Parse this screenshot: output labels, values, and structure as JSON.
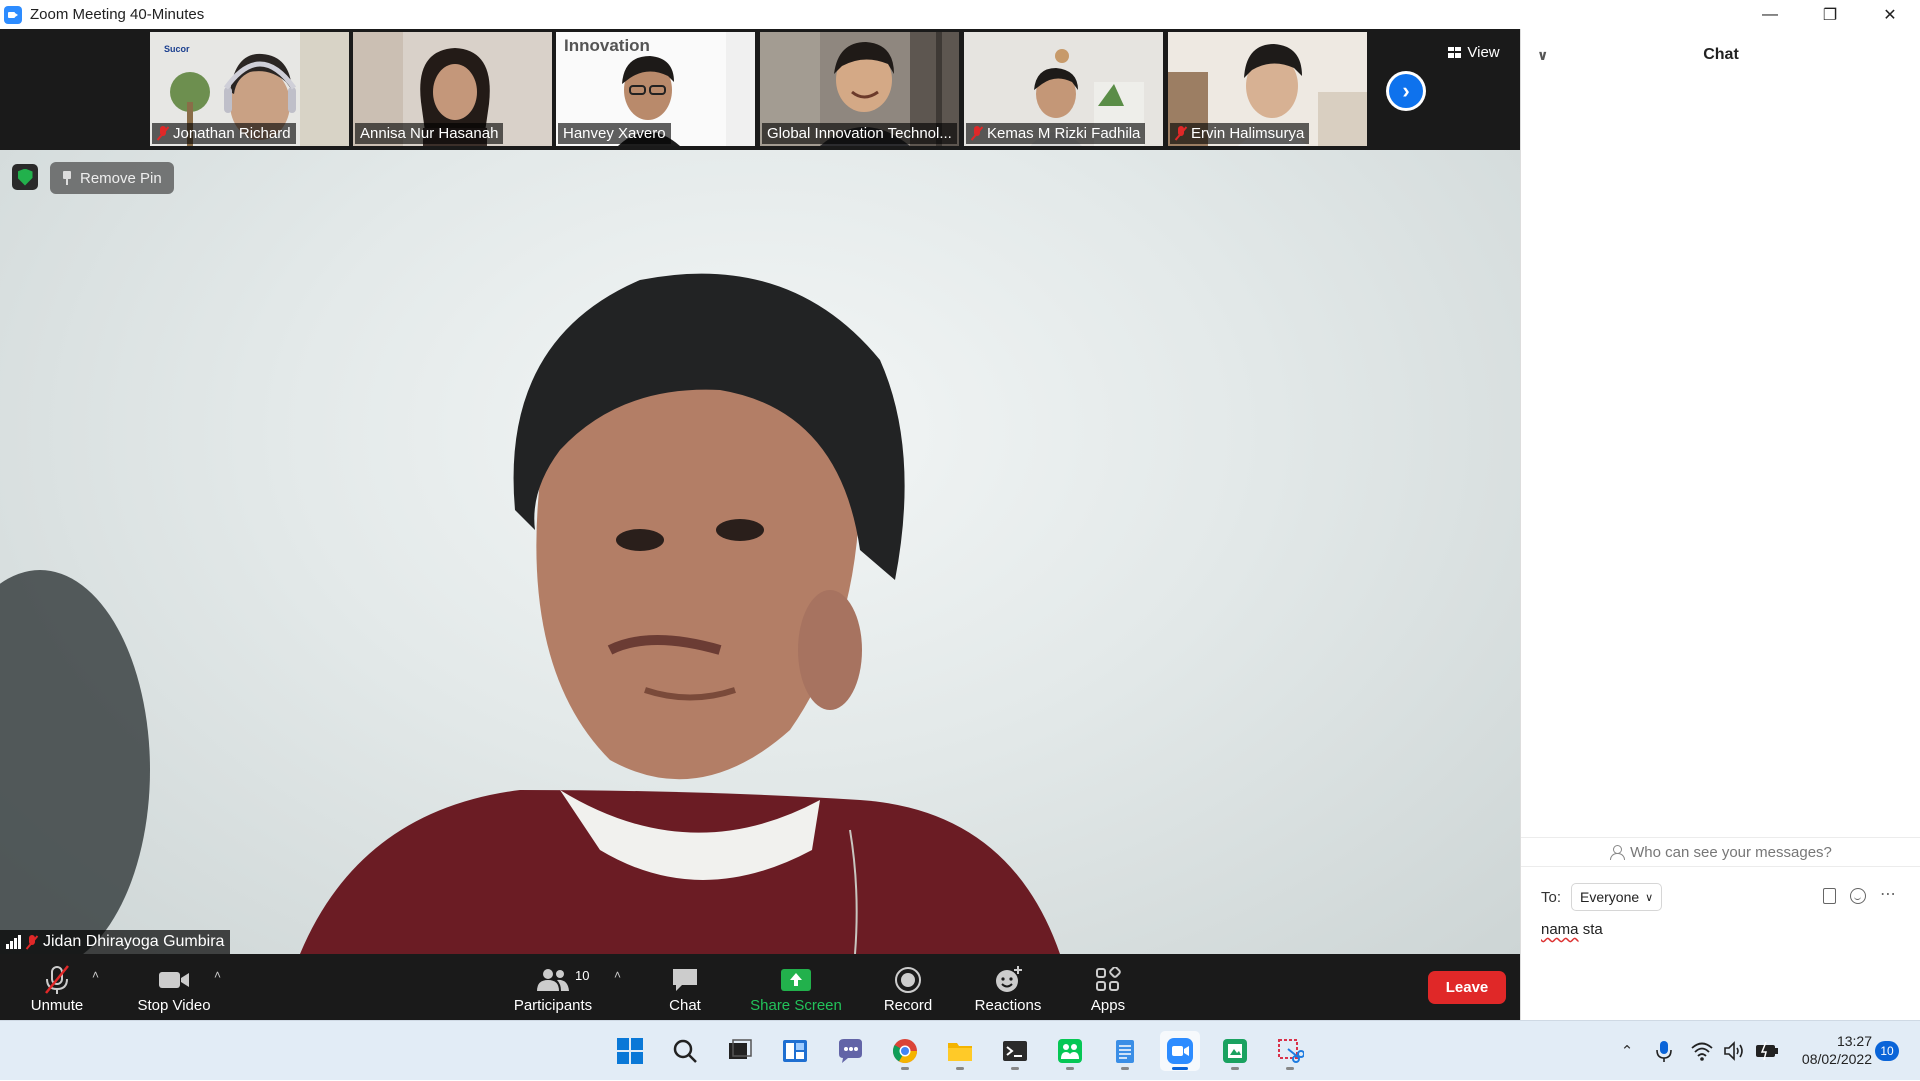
{
  "window": {
    "title": "Zoom Meeting 40-Minutes"
  },
  "strip": {
    "participants": [
      {
        "name": "Jonathan Richard",
        "muted": true,
        "banner": "Sucor"
      },
      {
        "name": "Annisa Nur Hasanah",
        "muted": false
      },
      {
        "name": "Hanvey Xavero",
        "muted": false,
        "banner": "Innovation"
      },
      {
        "name": "Global Innovation Technol...",
        "muted": false
      },
      {
        "name": "Kemas M Rizki Fadhila",
        "muted": true
      },
      {
        "name": "Ervin Halimsurya",
        "muted": true
      }
    ],
    "view_label": "View"
  },
  "main": {
    "remove_pin_label": "Remove Pin",
    "speaker_name": "Jidan Dhirayoga Gumbira",
    "speaker_muted": true
  },
  "toolbar": {
    "unmute": "Unmute",
    "stop_video": "Stop Video",
    "participants": "Participants",
    "participants_count": "10",
    "chat": "Chat",
    "share_screen": "Share Screen",
    "record": "Record",
    "reactions": "Reactions",
    "apps": "Apps",
    "leave": "Leave"
  },
  "chat_panel": {
    "title": "Chat",
    "who_can_see": "Who can see your messages?",
    "to_label": "To:",
    "recipient": "Everyone",
    "draft_word1": "nama",
    "draft_word2": "sta"
  },
  "taskbar": {
    "time": "13:27",
    "date": "08/02/2022",
    "notifications": "10"
  },
  "colors": {
    "zoom_blue": "#0e72ed",
    "share_green": "#22b14c",
    "leave_red": "#e02828",
    "meeting_bg": "#1a1a1a",
    "taskbar_bg": "#e2ecf6"
  }
}
